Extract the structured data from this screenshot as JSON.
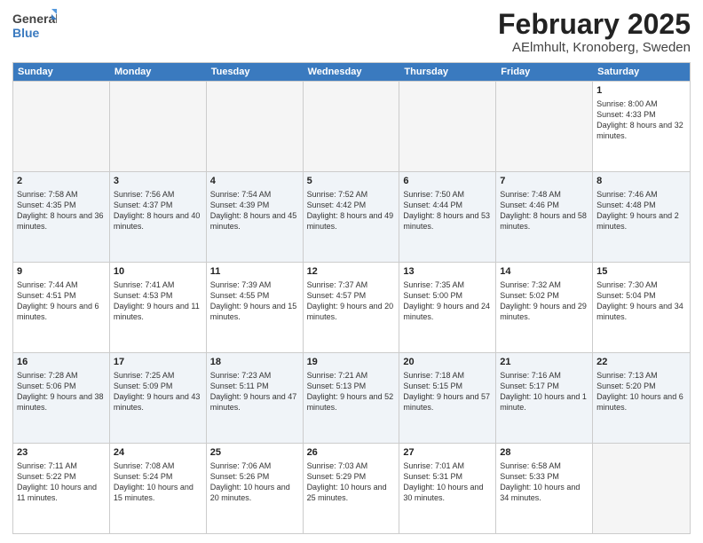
{
  "logo": {
    "line1": "General",
    "line2": "Blue"
  },
  "title": "February 2025",
  "subtitle": "AElmhult, Kronoberg, Sweden",
  "days": [
    "Sunday",
    "Monday",
    "Tuesday",
    "Wednesday",
    "Thursday",
    "Friday",
    "Saturday"
  ],
  "weeks": [
    [
      {
        "num": "",
        "info": ""
      },
      {
        "num": "",
        "info": ""
      },
      {
        "num": "",
        "info": ""
      },
      {
        "num": "",
        "info": ""
      },
      {
        "num": "",
        "info": ""
      },
      {
        "num": "",
        "info": ""
      },
      {
        "num": "1",
        "info": "Sunrise: 8:00 AM\nSunset: 4:33 PM\nDaylight: 8 hours and 32 minutes."
      }
    ],
    [
      {
        "num": "2",
        "info": "Sunrise: 7:58 AM\nSunset: 4:35 PM\nDaylight: 8 hours and 36 minutes."
      },
      {
        "num": "3",
        "info": "Sunrise: 7:56 AM\nSunset: 4:37 PM\nDaylight: 8 hours and 40 minutes."
      },
      {
        "num": "4",
        "info": "Sunrise: 7:54 AM\nSunset: 4:39 PM\nDaylight: 8 hours and 45 minutes."
      },
      {
        "num": "5",
        "info": "Sunrise: 7:52 AM\nSunset: 4:42 PM\nDaylight: 8 hours and 49 minutes."
      },
      {
        "num": "6",
        "info": "Sunrise: 7:50 AM\nSunset: 4:44 PM\nDaylight: 8 hours and 53 minutes."
      },
      {
        "num": "7",
        "info": "Sunrise: 7:48 AM\nSunset: 4:46 PM\nDaylight: 8 hours and 58 minutes."
      },
      {
        "num": "8",
        "info": "Sunrise: 7:46 AM\nSunset: 4:48 PM\nDaylight: 9 hours and 2 minutes."
      }
    ],
    [
      {
        "num": "9",
        "info": "Sunrise: 7:44 AM\nSunset: 4:51 PM\nDaylight: 9 hours and 6 minutes."
      },
      {
        "num": "10",
        "info": "Sunrise: 7:41 AM\nSunset: 4:53 PM\nDaylight: 9 hours and 11 minutes."
      },
      {
        "num": "11",
        "info": "Sunrise: 7:39 AM\nSunset: 4:55 PM\nDaylight: 9 hours and 15 minutes."
      },
      {
        "num": "12",
        "info": "Sunrise: 7:37 AM\nSunset: 4:57 PM\nDaylight: 9 hours and 20 minutes."
      },
      {
        "num": "13",
        "info": "Sunrise: 7:35 AM\nSunset: 5:00 PM\nDaylight: 9 hours and 24 minutes."
      },
      {
        "num": "14",
        "info": "Sunrise: 7:32 AM\nSunset: 5:02 PM\nDaylight: 9 hours and 29 minutes."
      },
      {
        "num": "15",
        "info": "Sunrise: 7:30 AM\nSunset: 5:04 PM\nDaylight: 9 hours and 34 minutes."
      }
    ],
    [
      {
        "num": "16",
        "info": "Sunrise: 7:28 AM\nSunset: 5:06 PM\nDaylight: 9 hours and 38 minutes."
      },
      {
        "num": "17",
        "info": "Sunrise: 7:25 AM\nSunset: 5:09 PM\nDaylight: 9 hours and 43 minutes."
      },
      {
        "num": "18",
        "info": "Sunrise: 7:23 AM\nSunset: 5:11 PM\nDaylight: 9 hours and 47 minutes."
      },
      {
        "num": "19",
        "info": "Sunrise: 7:21 AM\nSunset: 5:13 PM\nDaylight: 9 hours and 52 minutes."
      },
      {
        "num": "20",
        "info": "Sunrise: 7:18 AM\nSunset: 5:15 PM\nDaylight: 9 hours and 57 minutes."
      },
      {
        "num": "21",
        "info": "Sunrise: 7:16 AM\nSunset: 5:17 PM\nDaylight: 10 hours and 1 minute."
      },
      {
        "num": "22",
        "info": "Sunrise: 7:13 AM\nSunset: 5:20 PM\nDaylight: 10 hours and 6 minutes."
      }
    ],
    [
      {
        "num": "23",
        "info": "Sunrise: 7:11 AM\nSunset: 5:22 PM\nDaylight: 10 hours and 11 minutes."
      },
      {
        "num": "24",
        "info": "Sunrise: 7:08 AM\nSunset: 5:24 PM\nDaylight: 10 hours and 15 minutes."
      },
      {
        "num": "25",
        "info": "Sunrise: 7:06 AM\nSunset: 5:26 PM\nDaylight: 10 hours and 20 minutes."
      },
      {
        "num": "26",
        "info": "Sunrise: 7:03 AM\nSunset: 5:29 PM\nDaylight: 10 hours and 25 minutes."
      },
      {
        "num": "27",
        "info": "Sunrise: 7:01 AM\nSunset: 5:31 PM\nDaylight: 10 hours and 30 minutes."
      },
      {
        "num": "28",
        "info": "Sunrise: 6:58 AM\nSunset: 5:33 PM\nDaylight: 10 hours and 34 minutes."
      },
      {
        "num": "",
        "info": ""
      }
    ]
  ]
}
